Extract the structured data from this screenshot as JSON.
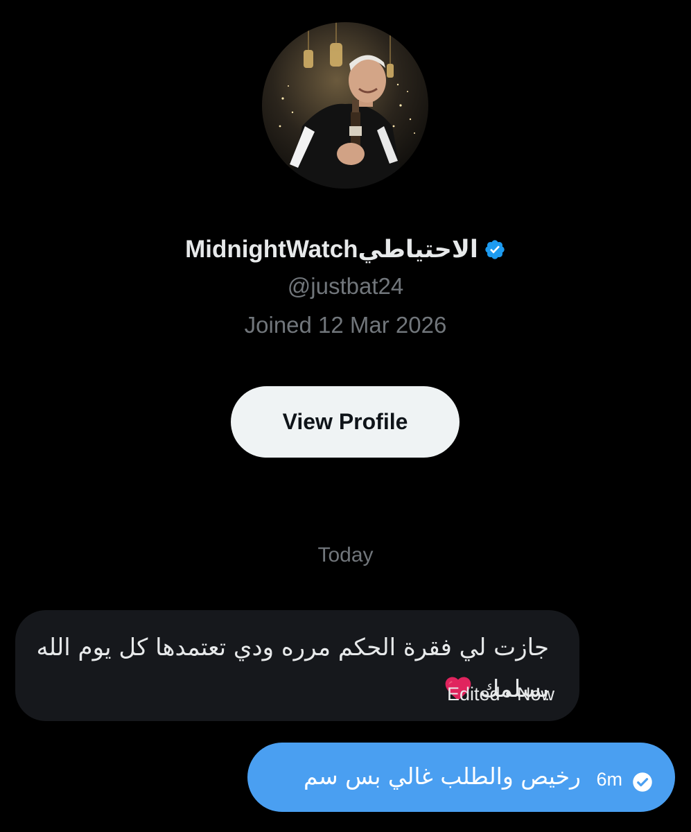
{
  "profile": {
    "display_name": "الاحتياطيMidnightWatch",
    "verified": true,
    "handle": "@justbat24",
    "joined": "Joined 12 Mar 2026",
    "avatar_icon": "user-avatar-photo",
    "view_profile_label": "View Profile"
  },
  "conversation": {
    "date_separator": "Today",
    "messages": [
      {
        "direction": "incoming",
        "text": "جازت لي فقرة الحكم مرره ودي تعتمدها كل يوم الله يسلمك",
        "emoji_icon": "red-heart-icon",
        "meta": "Edited • Now"
      },
      {
        "direction": "outgoing",
        "text": "رخيص والطلب غالي بس سم",
        "time": "6m",
        "status_icon": "sent-check-icon"
      }
    ]
  },
  "colors": {
    "background": "#000000",
    "primary_text": "#e7e9ea",
    "secondary_text": "#71767b",
    "verified_blue": "#1d9bf0",
    "incoming_bubble": "#16181c",
    "outgoing_bubble": "#4a9ff1",
    "button_bg": "#eff3f4",
    "button_text": "#0f1419",
    "heart": "#e0245e"
  }
}
